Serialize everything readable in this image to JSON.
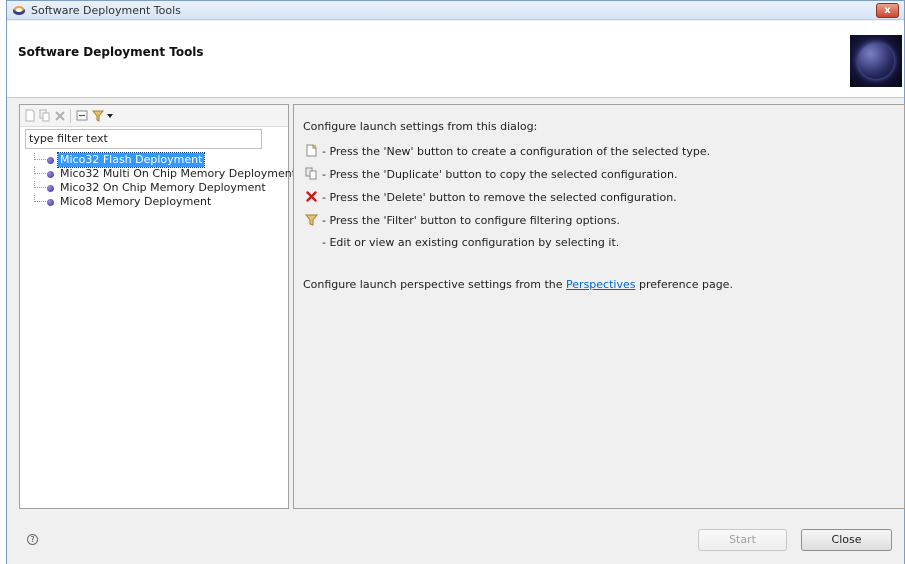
{
  "window": {
    "title": "Software Deployment Tools",
    "close_label": "x"
  },
  "header": {
    "heading": "Software Deployment Tools"
  },
  "left": {
    "filter_placeholder": "type filter text",
    "toolbar_icons": [
      "new-config-icon",
      "duplicate-icon",
      "delete-icon",
      "collapse-all-icon",
      "filter-icon",
      "view-menu-icon"
    ],
    "items": [
      {
        "label": "Mico32 Flash Deployment",
        "selected": true
      },
      {
        "label": "Mico32 Multi On Chip Memory Deployment",
        "selected": false
      },
      {
        "label": "Mico32 On Chip Memory Deployment",
        "selected": false
      },
      {
        "label": "Mico8 Memory Deployment",
        "selected": false
      }
    ]
  },
  "right": {
    "intro": "Configure launch settings from this dialog:",
    "hints": [
      {
        "icon": "new-icon",
        "text": "- Press the 'New' button to create a configuration of the selected type."
      },
      {
        "icon": "duplicate-icon",
        "text": "- Press the 'Duplicate' button to copy the selected configuration."
      },
      {
        "icon": "delete-icon",
        "text": "- Press the 'Delete' button to remove the selected configuration."
      },
      {
        "icon": "filter-icon",
        "text": "- Press the 'Filter' button to configure filtering options."
      },
      {
        "icon": "",
        "text": "- Edit or view an existing configuration by selecting it."
      }
    ],
    "perspective_prefix": "Configure launch perspective settings from the ",
    "perspective_link": "Perspectives",
    "perspective_suffix": " preference page."
  },
  "footer": {
    "help_label": "?",
    "start_label": "Start",
    "close_label": "Close"
  },
  "colors": {
    "selection": "#3399ff",
    "link": "#0066cc",
    "delete_red": "#c81e1e"
  }
}
